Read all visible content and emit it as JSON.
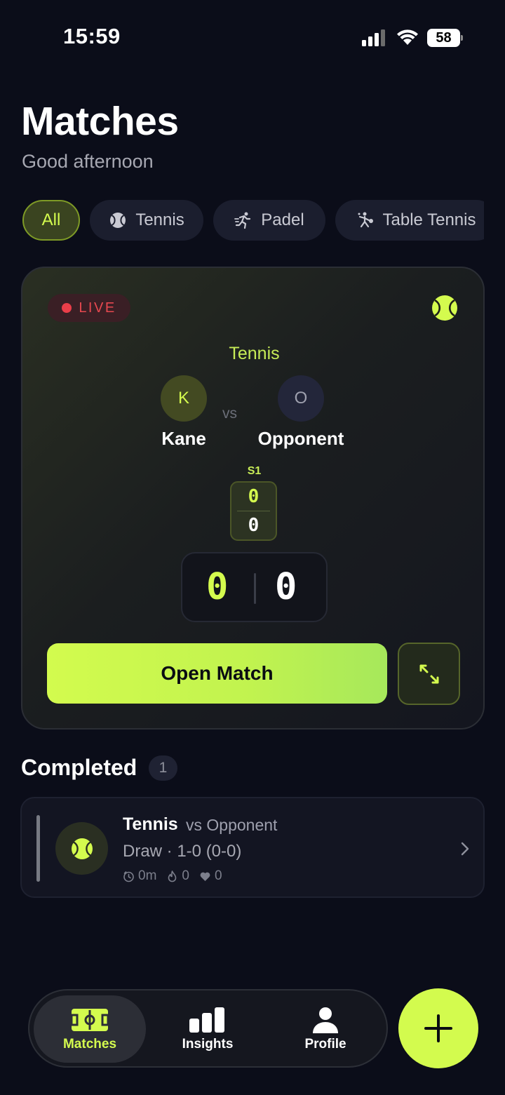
{
  "status_bar": {
    "time": "15:59",
    "battery": "58"
  },
  "header": {
    "title": "Matches",
    "greeting": "Good afternoon"
  },
  "filters": [
    {
      "label": "All",
      "icon": "none"
    },
    {
      "label": "Tennis",
      "icon": "tennis-ball-icon"
    },
    {
      "label": "Padel",
      "icon": "runner-icon"
    },
    {
      "label": "Table Tennis",
      "icon": "table-tennis-player-icon"
    }
  ],
  "live_match": {
    "badge": "LIVE",
    "sport": "Tennis",
    "vs": "vs",
    "player1": {
      "initial": "K",
      "name": "Kane"
    },
    "player2": {
      "initial": "O",
      "name": "Opponent"
    },
    "set_label": "S1",
    "set_score": {
      "p1": "0",
      "p2": "0"
    },
    "game_score": {
      "p1": "0",
      "p2": "0"
    },
    "open_button": "Open Match",
    "colors": {
      "accent": "#d4fb4e",
      "live": "#ea3e49"
    }
  },
  "completed": {
    "title": "Completed",
    "count": "1",
    "items": [
      {
        "sport": "Tennis",
        "opponent": "vs Opponent",
        "result": "Draw · 1-0 (0-0)",
        "duration": "0m",
        "calories": "0",
        "heart": "0"
      }
    ]
  },
  "tab_bar": {
    "tabs": [
      {
        "label": "Matches",
        "icon": "court-icon"
      },
      {
        "label": "Insights",
        "icon": "bar-chart-icon"
      },
      {
        "label": "Profile",
        "icon": "person-icon"
      }
    ]
  }
}
